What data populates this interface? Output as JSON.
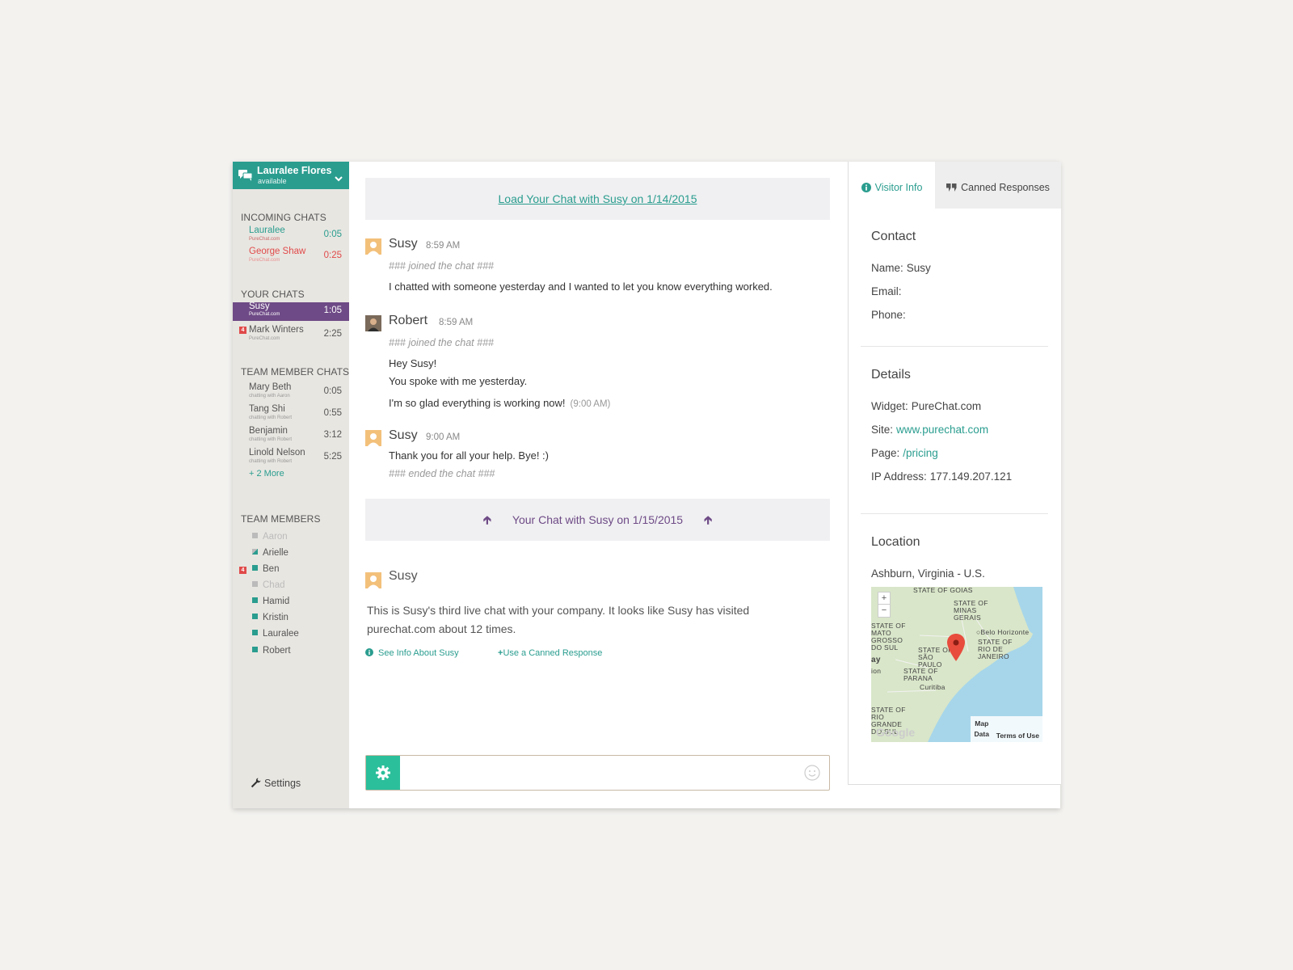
{
  "user": {
    "name": "Lauralee Flores",
    "status": "available"
  },
  "sidebar": {
    "incoming_title": "INCOMING CHATS",
    "incoming": [
      {
        "name": "Lauralee",
        "site": "PureChat.com",
        "time": "0:05"
      },
      {
        "name": "George Shaw",
        "site": "PureChat.com",
        "time": "0:25"
      }
    ],
    "your_title": "YOUR CHATS",
    "yours": [
      {
        "name": "Susy",
        "site": "PureChat.com",
        "time": "1:05"
      },
      {
        "name": "Mark Winters",
        "site": "PureChat.com",
        "time": "2:25",
        "badge": "4"
      }
    ],
    "team_chats_title": "TEAM MEMBER CHATS",
    "team_chats": [
      {
        "name": "Mary Beth",
        "sub": "chatting with Aaron",
        "time": "0:05"
      },
      {
        "name": "Tang Shi",
        "sub": "chatting with Robert",
        "time": "0:55"
      },
      {
        "name": "Benjamin",
        "sub": "chatting with Robert",
        "time": "3:12"
      },
      {
        "name": "Linold Nelson",
        "sub": "chatting with Robert",
        "time": "5:25"
      }
    ],
    "more_label": "+ 2 More",
    "members_title": "TEAM MEMBERS",
    "members": [
      {
        "name": "Aaron"
      },
      {
        "name": "Arielle"
      },
      {
        "name": "Ben",
        "badge": "4"
      },
      {
        "name": "Chad"
      },
      {
        "name": "Hamid"
      },
      {
        "name": "Kristin"
      },
      {
        "name": "Lauralee"
      },
      {
        "name": "Robert"
      }
    ],
    "settings_label": "Settings"
  },
  "chat": {
    "load_banner": "Load Your Chat with Susy on 1/14/2015",
    "current_banner": "Your Chat with Susy on 1/15/2015",
    "messages": [
      {
        "name": "Susy",
        "time": "8:59 AM",
        "system": "### joined the chat ###",
        "lines": [
          "I chatted with someone yesterday and I wanted to let you know everything worked."
        ]
      },
      {
        "name": "Robert",
        "time": "8:59 AM",
        "system": "### joined the chat ###",
        "lines": [
          "Hey Susy!",
          "You spoke with me yesterday.",
          "I'm so glad everything is working now!"
        ],
        "late_time": "(9:00 AM)"
      },
      {
        "name": "Susy",
        "time": "9:00 AM",
        "lines": [
          "Thank you for all your help.  Bye! :)"
        ],
        "system_end": "### ended the chat ###"
      }
    ],
    "summary": {
      "name": "Susy",
      "text": "This is Susy's third live chat with your company. It looks like Susy has visited purechat.com about 12 times.",
      "see_info": "See Info About Susy",
      "canned": "Use a Canned Response"
    },
    "input_placeholder": ""
  },
  "panel": {
    "tab_visitor": "Visitor Info",
    "tab_canned": "Canned Responses",
    "contact_title": "Contact",
    "name_label": "Name:",
    "name_value": "Susy",
    "email_label": "Email:",
    "phone_label": "Phone:",
    "details_title": "Details",
    "widget_label": "Widget:",
    "widget_value": "PureChat.com",
    "site_label": "Site:",
    "site_value": "www.purechat.com",
    "page_label": "Page:",
    "page_value": "/pricing",
    "ip_label": "IP Address:",
    "ip_value": "177.149.207.121",
    "location_title": "Location",
    "location_value": "Ashburn, Virginia - U.S.",
    "map": {
      "labels": [
        "STATE OF GOIAS",
        "STATE OF MINAS GERAIS",
        "STATE OF MATO GROSSO DO SUL",
        "Belo Horizonte",
        "STATE OF RIO DE JANEIRO",
        "STATE OF SÃO PAULO",
        "STATE OF PARANA",
        "Curitiba",
        "STATE OF RIO GRANDE DO SUL",
        "ay",
        "ion"
      ],
      "zoom_in": "+",
      "zoom_out": "−",
      "map_data": "Map Data",
      "terms": "Terms of Use",
      "provider": "Google"
    }
  },
  "colors": {
    "teal": "#2a9d8f",
    "purple": "#6e4a86",
    "red": "#e04a4a",
    "sidebar_bg": "#e8e6e1"
  }
}
